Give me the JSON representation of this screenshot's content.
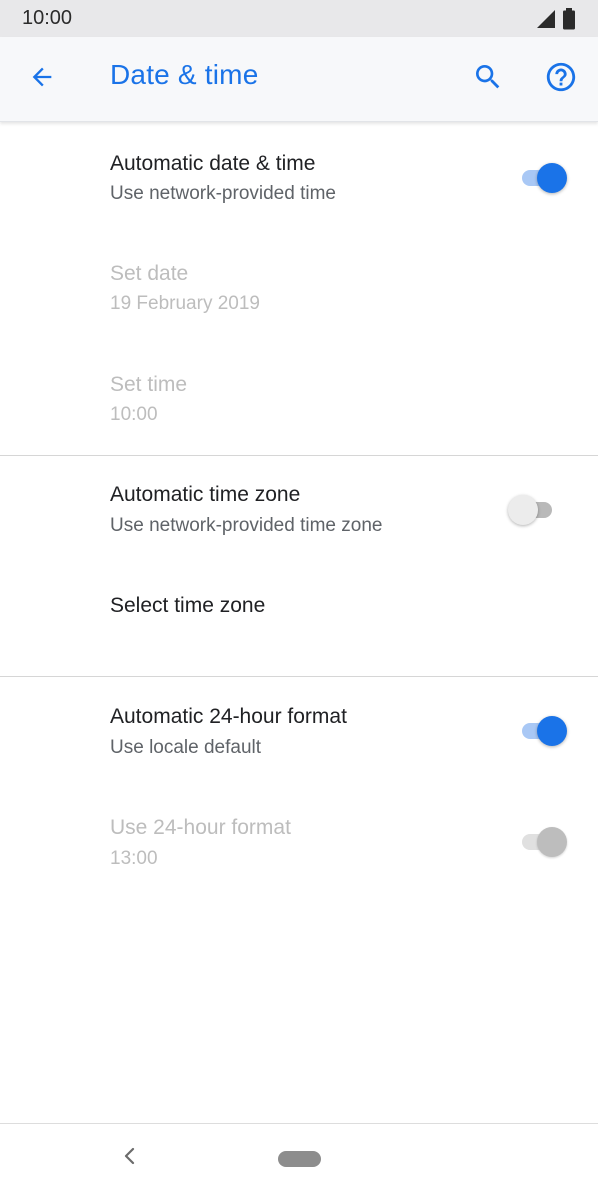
{
  "status_bar": {
    "time": "10:00",
    "icons": [
      "signal-icon",
      "battery-icon"
    ]
  },
  "app_bar": {
    "title": "Date & time",
    "icons": [
      "back-arrow-icon",
      "search-icon",
      "help-icon"
    ],
    "accent_color": "#1a73e8"
  },
  "settings": {
    "automatic_date_time": {
      "title": "Automatic date & time",
      "subtitle": "Use network-provided time",
      "toggle": "on"
    },
    "set_date": {
      "title": "Set date",
      "subtitle": "19 February 2019",
      "enabled": false
    },
    "set_time": {
      "title": "Set time",
      "subtitle": "10:00",
      "enabled": false
    },
    "automatic_time_zone": {
      "title": "Automatic time zone",
      "subtitle": "Use network-provided time zone",
      "toggle": "off"
    },
    "select_time_zone": {
      "title": "Select time zone"
    },
    "automatic_24_hour": {
      "title": "Automatic 24-hour format",
      "subtitle": "Use locale default",
      "toggle": "on"
    },
    "use_24_hour": {
      "title": "Use 24-hour format",
      "subtitle": "13:00",
      "toggle": "on",
      "enabled": false
    }
  },
  "nav_bar": {
    "icons": [
      "nav-back-icon",
      "home-pill-icon"
    ]
  }
}
